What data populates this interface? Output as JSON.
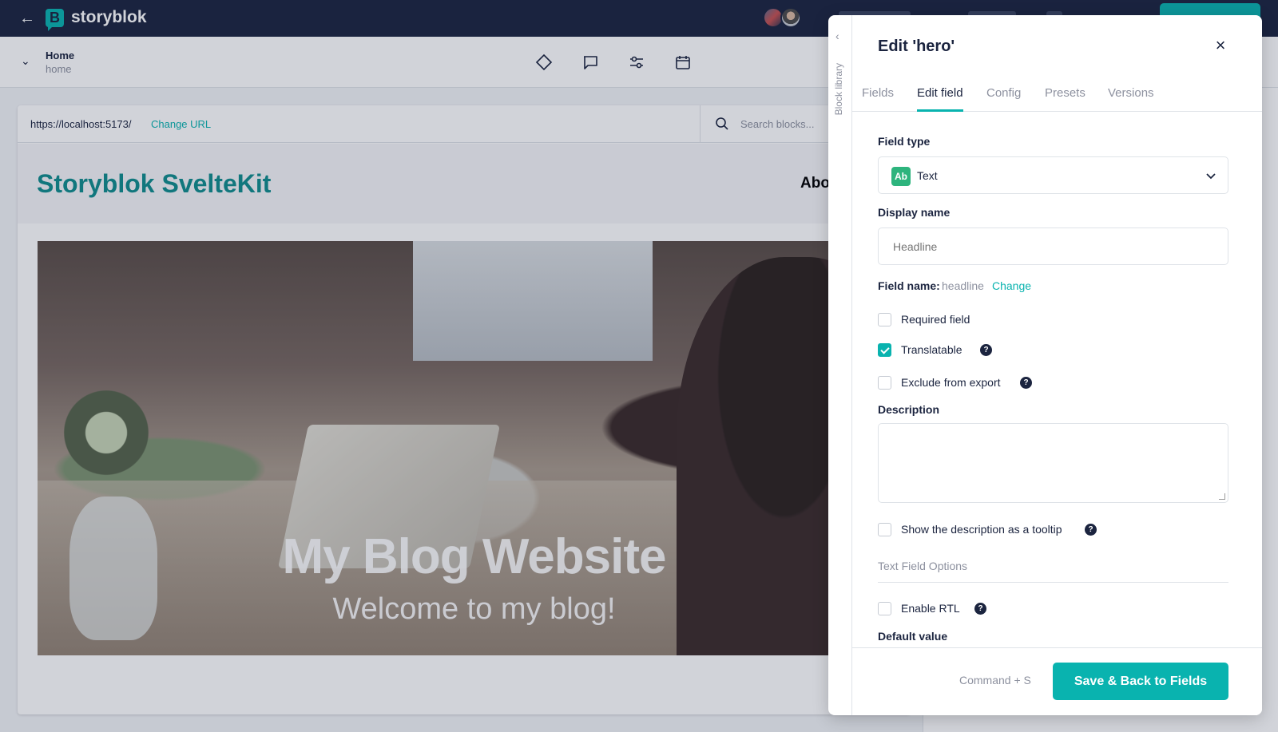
{
  "app": {
    "brand": "storyblok",
    "logo_letter": "B"
  },
  "story": {
    "name": "Home",
    "slug": "home"
  },
  "preview": {
    "url": "https://localhost:5173/",
    "change_url_label": "Change URL",
    "search_placeholder": "Search blocks...",
    "site_title": "Storyblok SvelteKit",
    "site_nav_item": "Abo",
    "hero_headline": "My Blog Website",
    "hero_subheadline": "Welcome to my blog!"
  },
  "drawer": {
    "side_label": "Block library",
    "title": "Edit 'hero'",
    "tabs": [
      {
        "label": "Fields"
      },
      {
        "label": "Edit field"
      },
      {
        "label": "Config"
      },
      {
        "label": "Presets"
      },
      {
        "label": "Versions"
      }
    ],
    "active_tab": "Edit field",
    "field_type": {
      "label": "Field type",
      "badge": "Ab",
      "value": "Text"
    },
    "display_name": {
      "label": "Display name",
      "placeholder": "Headline"
    },
    "field_name": {
      "label": "Field name:",
      "value": "headline",
      "change_label": "Change"
    },
    "options": [
      {
        "label": "Required field",
        "checked": false
      },
      {
        "label": "Translatable",
        "checked": true
      },
      {
        "label": "Exclude from export",
        "checked": false
      }
    ],
    "description": {
      "label": "Description",
      "value": ""
    },
    "tooltip_option": {
      "label": "Show the description as a tooltip",
      "checked": false
    },
    "section_title": "Text Field Options",
    "rtl_option": {
      "label": "Enable RTL",
      "checked": false
    },
    "cut_label": "Default value",
    "help_glyph": "?",
    "footer": {
      "shortcut": "Command + S",
      "save_label": "Save & Back to Fields"
    }
  },
  "colors": {
    "accent": "#09b3af",
    "navy": "#1b243f",
    "muted": "#8d919f"
  }
}
